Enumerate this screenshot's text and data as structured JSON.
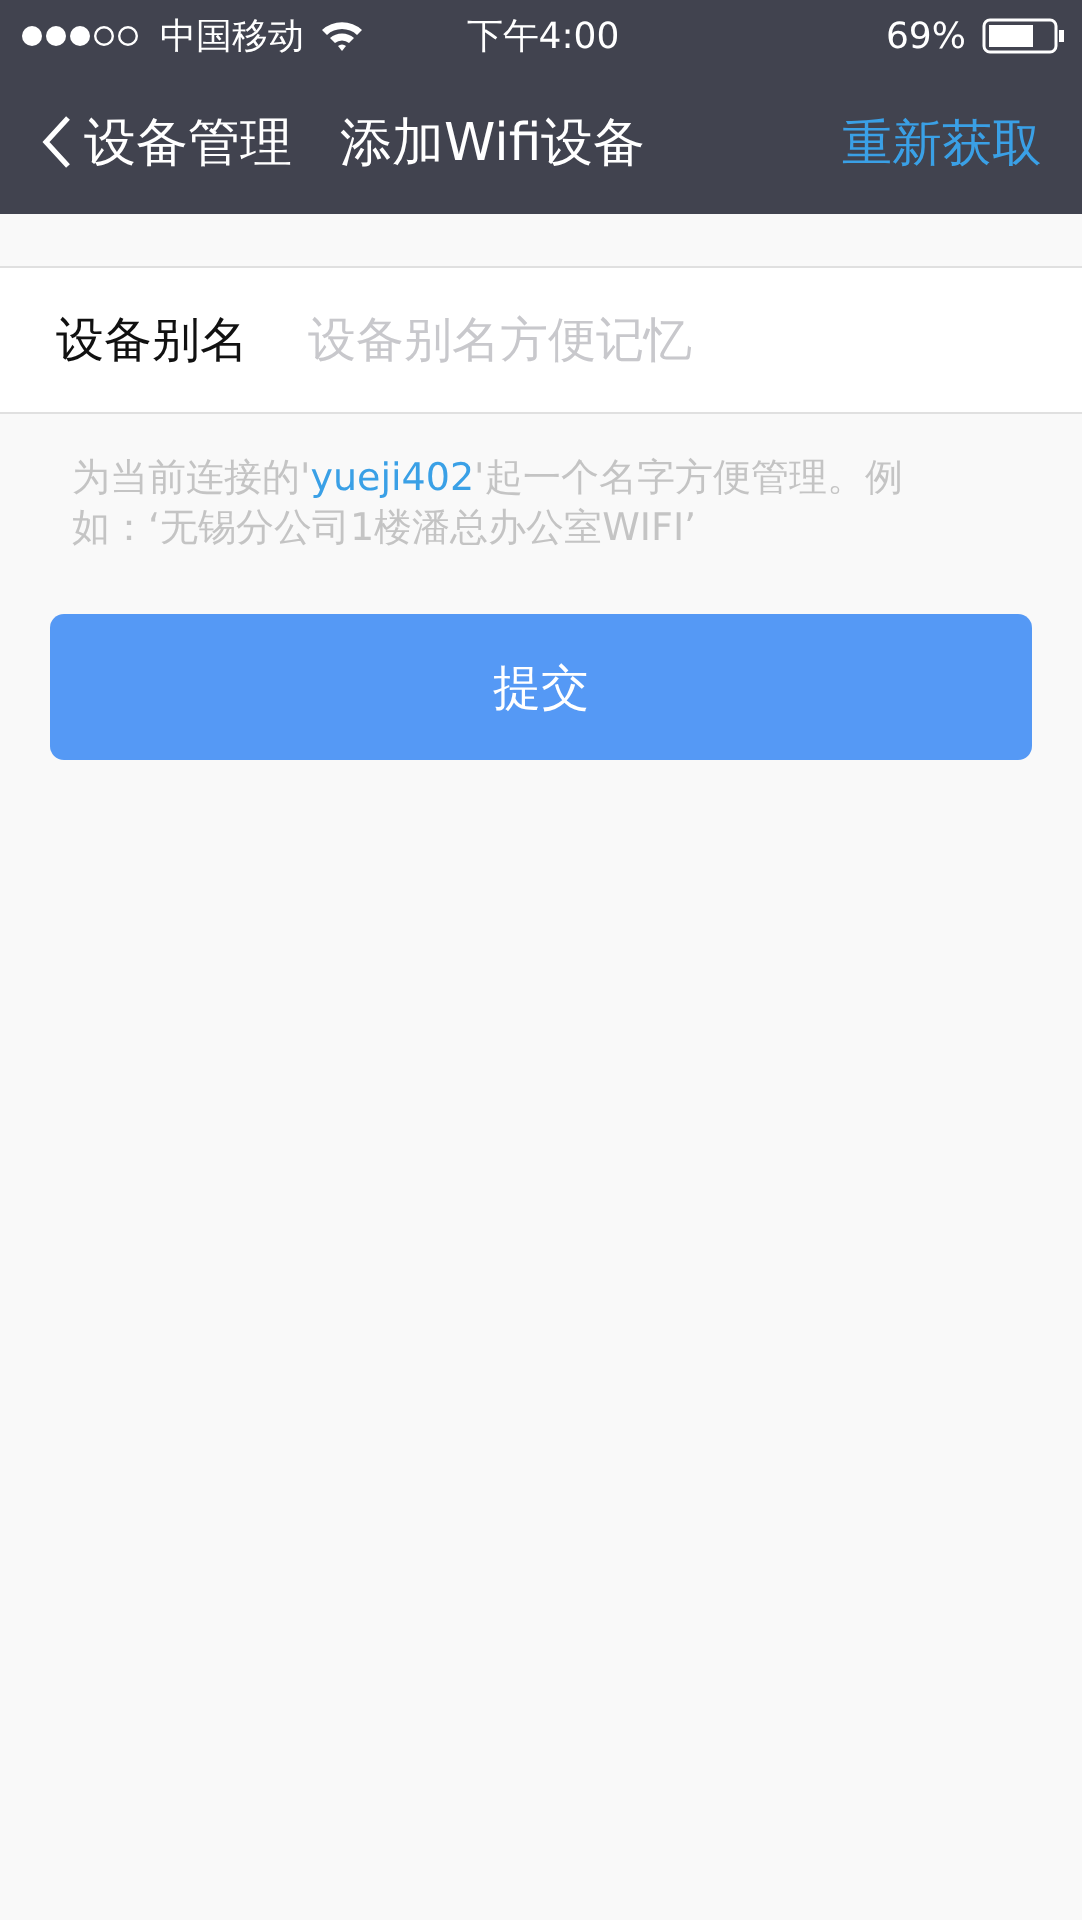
{
  "status_bar": {
    "carrier": "中国移动",
    "time": "下午4:00",
    "battery": "69%"
  },
  "nav": {
    "back": "设备管理",
    "title": "添加Wifi设备",
    "action": "重新获取"
  },
  "field": {
    "label": "设备别名",
    "placeholder": "设备别名方便记忆"
  },
  "hint": {
    "before": "为当前连接的'",
    "highlight": "yueji402",
    "after": "'起一个名字方便管理。例如：‘无锡分公司1楼潘总办公室WIFI’"
  },
  "submit": "提交"
}
